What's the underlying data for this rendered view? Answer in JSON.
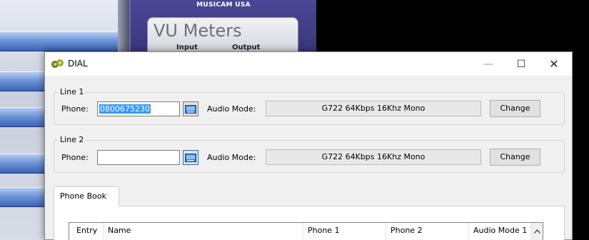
{
  "background_app": {
    "brand": "MUSICAM USA",
    "vu_title": "VU Meters",
    "vu_input_label": "Input",
    "vu_output_label": "Output"
  },
  "dialog": {
    "title": "DIAL",
    "window_controls": {
      "minimize": "—",
      "maximize": "☐",
      "close": "✕"
    }
  },
  "line1": {
    "group_label": "Line 1",
    "phone_label": "Phone:",
    "phone_value": "0800675230",
    "audio_mode_label": "Audio Mode:",
    "audio_mode_value": "G722 64Kbps 16Khz Mono",
    "change_label": "Change"
  },
  "line2": {
    "group_label": "Line 2",
    "phone_label": "Phone:",
    "phone_value": "",
    "audio_mode_label": "Audio Mode:",
    "audio_mode_value": "G722 64Kbps 16Khz Mono",
    "change_label": "Change"
  },
  "phone_book": {
    "tab_label": "Phone Book",
    "columns": [
      "Entry",
      "Name",
      "Phone 1",
      "Phone 2",
      "Audio Mode 1"
    ]
  },
  "icons": {
    "app_icon": "dial-app-icon",
    "keyboard": "keyboard-icon",
    "scroll_up": "scroll-up-arrow-icon"
  },
  "colors": {
    "selection": "#3399ff",
    "vu_panel": "#4b4796",
    "bg_bar": "#3c64b4"
  }
}
